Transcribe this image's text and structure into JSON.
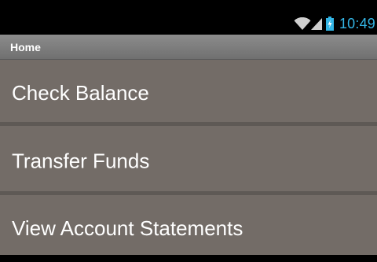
{
  "status_bar": {
    "time": "10:49",
    "icons": [
      "wifi-icon",
      "signal-icon",
      "battery-charging-icon"
    ],
    "accent_color": "#33b5e5"
  },
  "action_bar": {
    "title": "Home"
  },
  "menu": {
    "items": [
      {
        "label": "Check Balance"
      },
      {
        "label": "Transfer Funds"
      },
      {
        "label": "View Account Statements"
      }
    ]
  },
  "colors": {
    "list_background": "#736c67",
    "divider": "#5e5955",
    "action_bar": "#808080"
  }
}
